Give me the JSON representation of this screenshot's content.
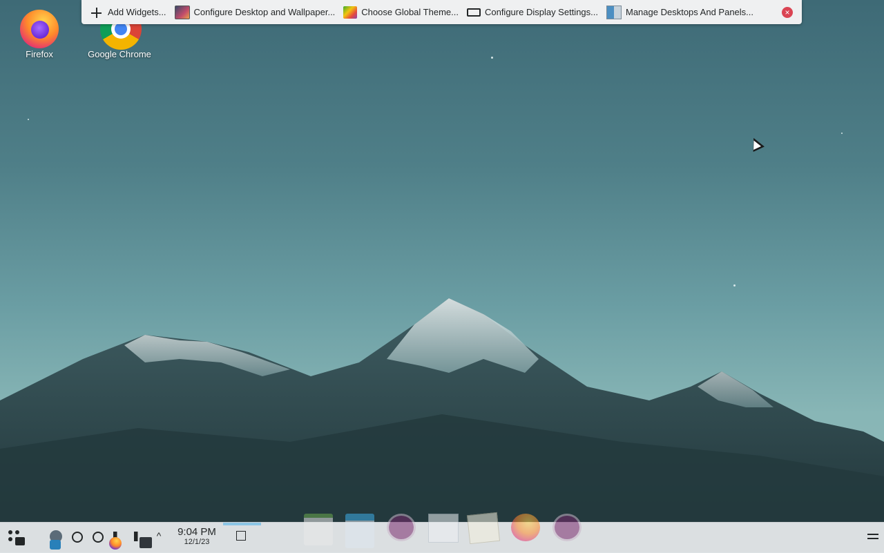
{
  "desktop": {
    "icons": [
      {
        "label": "Firefox",
        "icon": "firefox-icon"
      },
      {
        "label": "Google Chrome",
        "icon": "chrome-icon"
      }
    ]
  },
  "toolbox": {
    "items": [
      {
        "label": "Add Widgets...",
        "icon": "plus-icon"
      },
      {
        "label": "Configure Desktop and Wallpaper...",
        "icon": "wallpaper-icon"
      },
      {
        "label": "Choose Global Theme...",
        "icon": "theme-icon"
      },
      {
        "label": "Configure Display Settings...",
        "icon": "display-icon"
      },
      {
        "label": "Manage Desktops And Panels...",
        "icon": "desktops-icon"
      }
    ],
    "close_icon": "close-icon",
    "close_glyph": "×"
  },
  "panel": {
    "clock_time": "9:04 PM",
    "clock_date": "12/1/23",
    "accent_color": "#3daee9",
    "tasks": [
      "files-icon",
      "mail-icon",
      "media-player-icon",
      "window-icon",
      "image-viewer-icon",
      "firefox-icon",
      "media-player-icon"
    ]
  }
}
